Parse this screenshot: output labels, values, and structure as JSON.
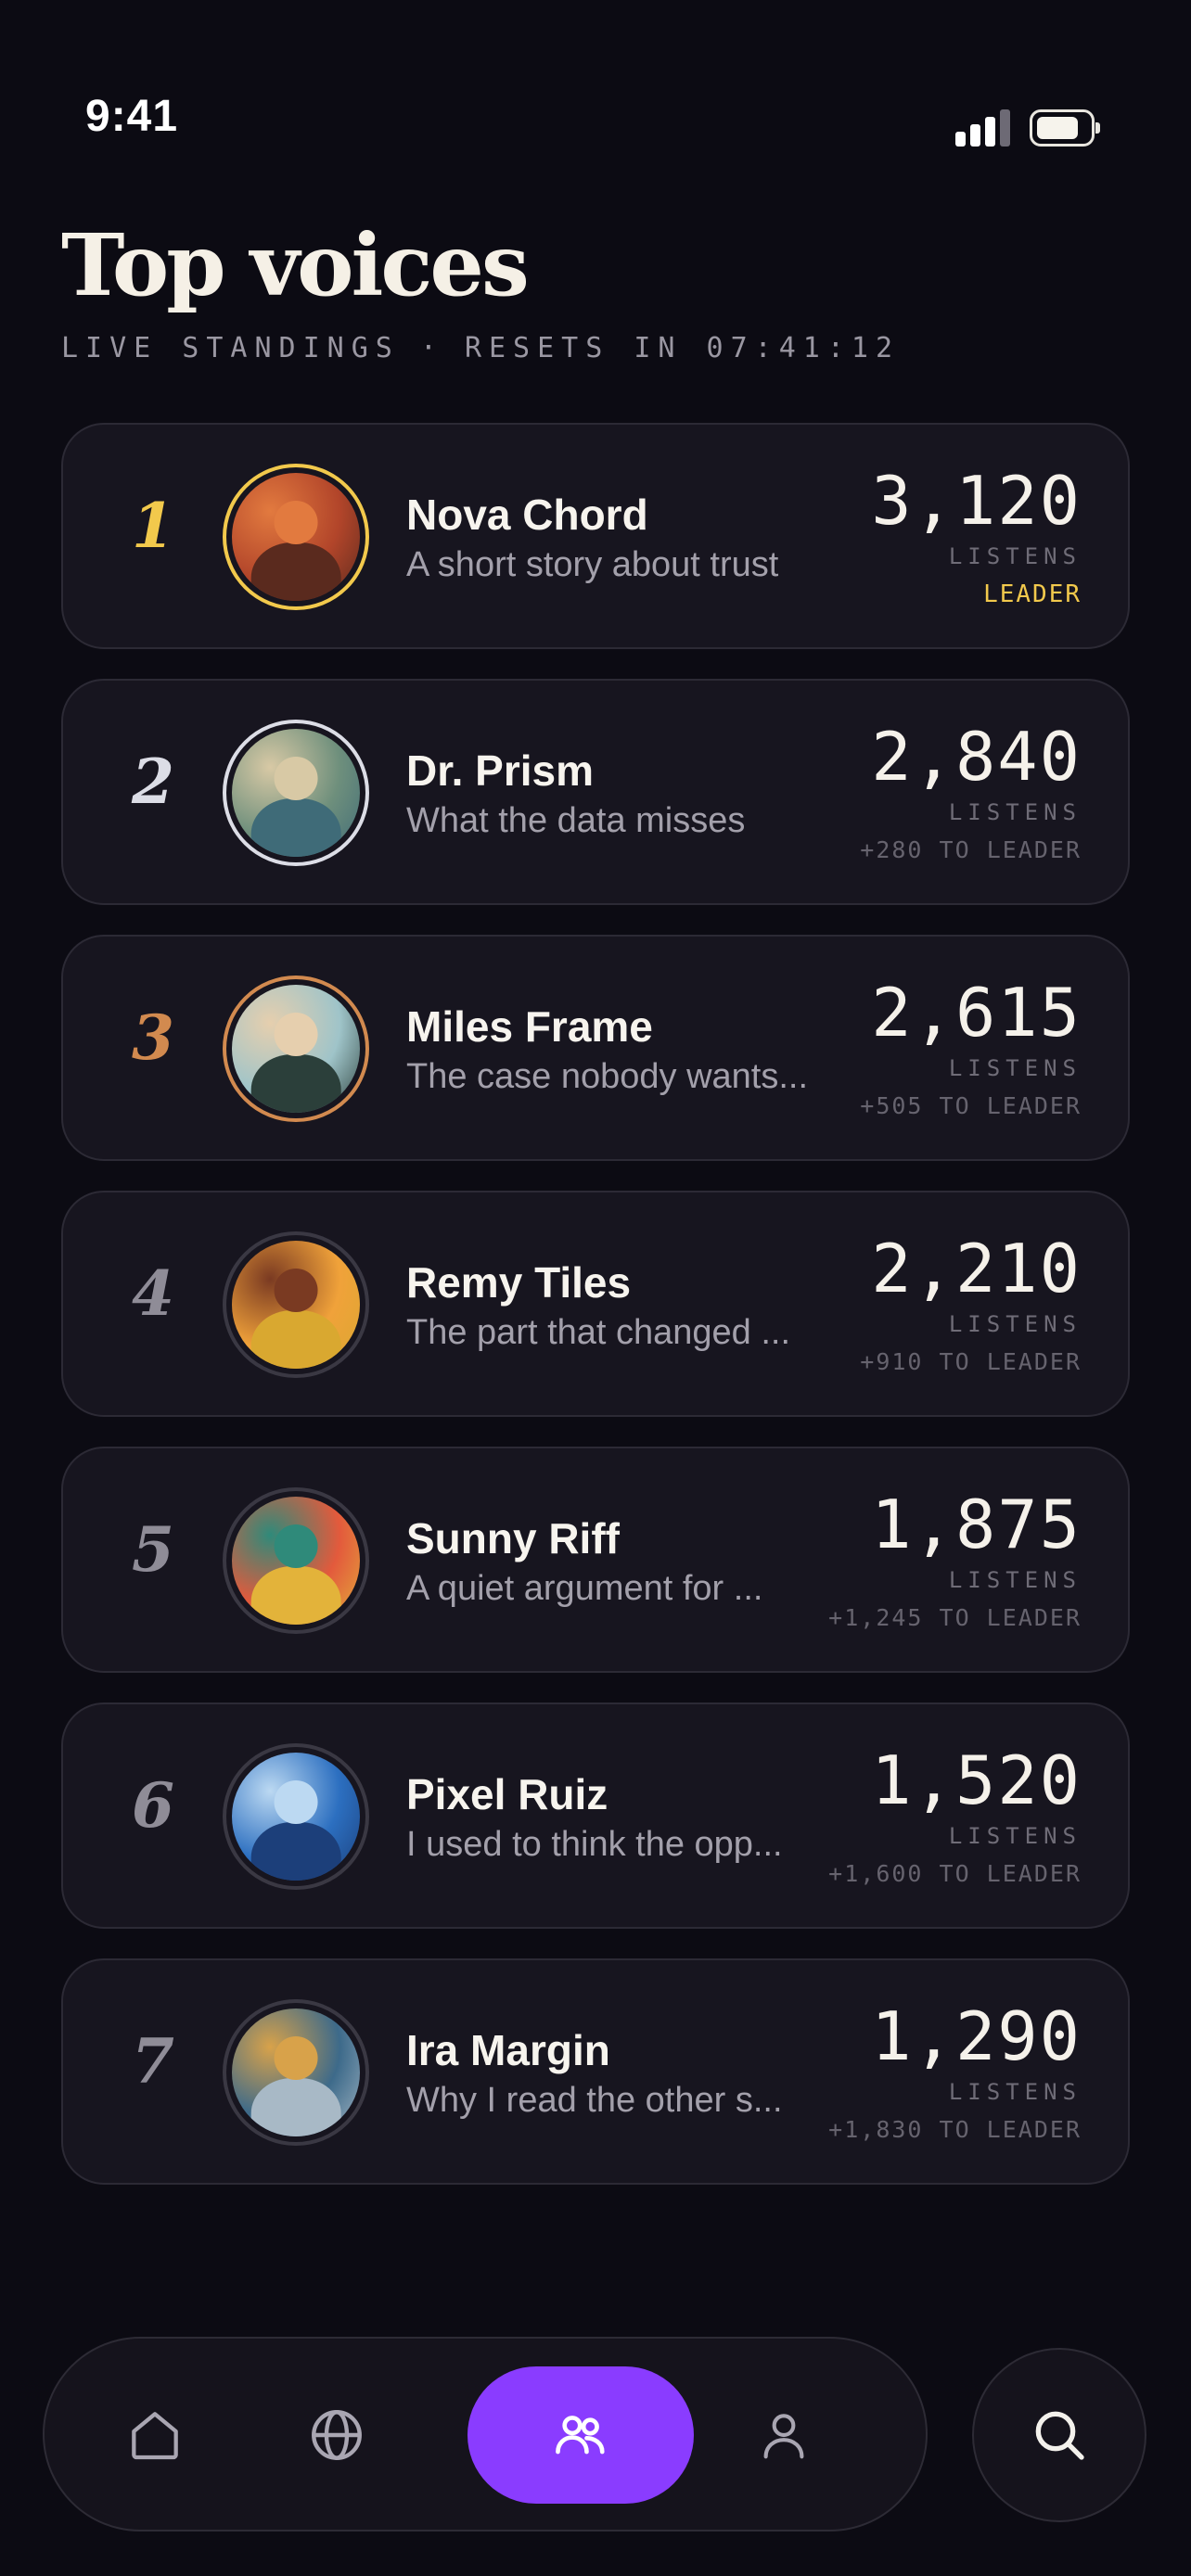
{
  "status_bar": {
    "time": "9:41"
  },
  "header": {
    "title": "Top voices",
    "subtitle_left": "LIVE STANDINGS",
    "subtitle_sep": "·",
    "subtitle_right": "RESETS IN 07:41:12"
  },
  "leaderboard": [
    {
      "rank": "1",
      "name": "Nova Chord",
      "description": "A short story about trust",
      "listens": "3,120",
      "unit": "LISTENS",
      "gap": "LEADER",
      "accent": "#f2c94c",
      "avatar_colors": [
        "#b2452a",
        "#e27a3f",
        "#5a2a1e"
      ]
    },
    {
      "rank": "2",
      "name": "Dr. Prism",
      "description": "What the data misses",
      "listens": "2,840",
      "unit": "LISTENS",
      "gap": "+280 TO LEADER",
      "accent": "#dcdde6",
      "avatar_colors": [
        "#6e8f7c",
        "#d8c9a5",
        "#3f6b78"
      ]
    },
    {
      "rank": "3",
      "name": "Miles Frame",
      "description": "The case nobody wants...",
      "listens": "2,615",
      "unit": "LISTENS",
      "gap": "+505 TO LEADER",
      "accent": "#d28a4f",
      "avatar_colors": [
        "#9fc4c9",
        "#e6cfae",
        "#2b3f3a"
      ]
    },
    {
      "rank": "4",
      "name": "Remy Tiles",
      "description": "The part that changed ...",
      "listens": "2,210",
      "unit": "LISTENS",
      "gap": "+910 TO LEADER",
      "accent": "#8f8c97",
      "avatar_colors": [
        "#f0a23a",
        "#7a3a22",
        "#d9a830"
      ]
    },
    {
      "rank": "5",
      "name": "Sunny Riff",
      "description": "A quiet argument for ...",
      "listens": "1,875",
      "unit": "LISTENS",
      "gap": "+1,245 TO LEADER",
      "accent": "#8f8c97",
      "avatar_colors": [
        "#e35a3c",
        "#2f8a7a",
        "#e3b33a"
      ]
    },
    {
      "rank": "6",
      "name": "Pixel Ruiz",
      "description": "I used to think the opp...",
      "listens": "1,520",
      "unit": "LISTENS",
      "gap": "+1,600 TO LEADER",
      "accent": "#8f8c97",
      "avatar_colors": [
        "#2c6fc0",
        "#bcd9f2",
        "#1c3f7a"
      ]
    },
    {
      "rank": "7",
      "name": "Ira Margin",
      "description": "Why I read the other s...",
      "listens": "1,290",
      "unit": "LISTENS",
      "gap": "+1,830 TO LEADER",
      "accent": "#8f8c97",
      "avatar_colors": [
        "#3d6a8a",
        "#d8a24a",
        "#a8b9c6"
      ]
    }
  ],
  "colors": {
    "accent_purple": "#8a3cff",
    "leader_gold": "#f2c94c",
    "background": "#0c0b13"
  },
  "tabbar": {
    "tabs": [
      {
        "icon": "home-icon",
        "active": false
      },
      {
        "icon": "globe-icon",
        "active": false
      },
      {
        "icon": "people-icon",
        "active": true
      },
      {
        "icon": "profile-icon",
        "active": false
      }
    ],
    "search_icon": "search-icon"
  }
}
